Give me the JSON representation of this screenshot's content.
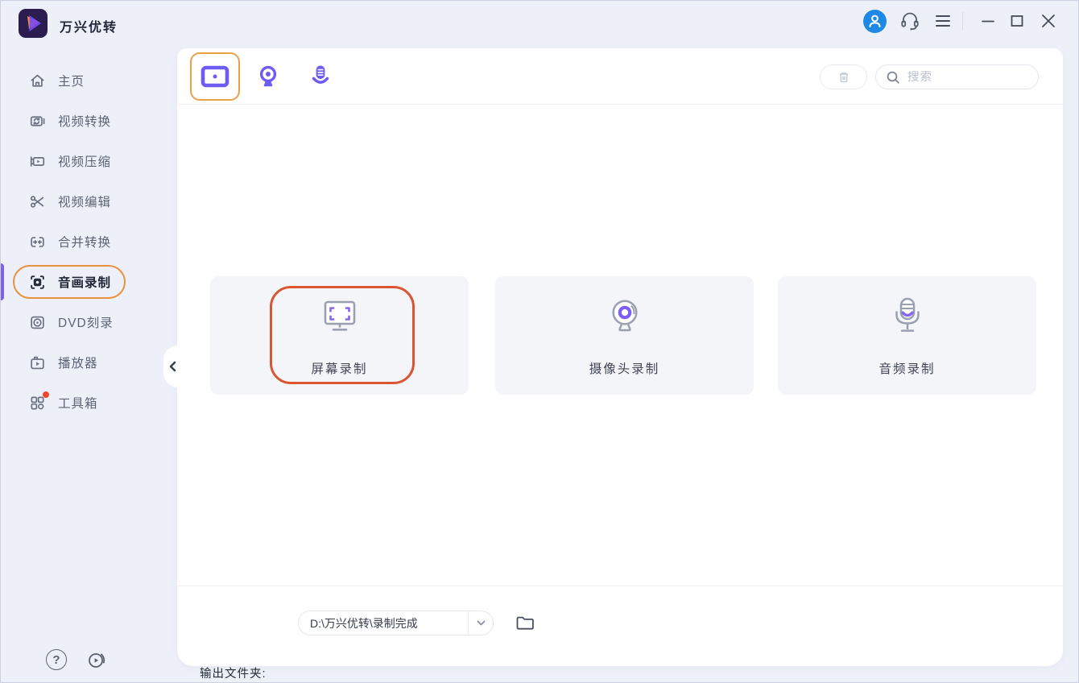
{
  "app": {
    "title": "万兴优转"
  },
  "titlebar": {
    "icons": [
      "user-avatar-icon",
      "headset-icon",
      "menu-icon",
      "minimize-icon",
      "maximize-icon",
      "close-icon"
    ]
  },
  "sidebar": {
    "items": [
      {
        "label": "主页",
        "icon": "home-icon",
        "active": false
      },
      {
        "label": "视频转换",
        "icon": "video-convert-icon",
        "active": false
      },
      {
        "label": "视频压缩",
        "icon": "video-compress-icon",
        "active": false
      },
      {
        "label": "视频编辑",
        "icon": "video-edit-icon",
        "active": false
      },
      {
        "label": "合并转换",
        "icon": "merge-convert-icon",
        "active": false
      },
      {
        "label": "音画录制",
        "icon": "record-icon",
        "active": true,
        "highlight": "orange-outline"
      },
      {
        "label": "DVD刻录",
        "icon": "dvd-icon",
        "active": false
      },
      {
        "label": "播放器",
        "icon": "player-icon",
        "active": false
      },
      {
        "label": "工具箱",
        "icon": "toolbox-icon",
        "active": false,
        "badge": "red-dot"
      }
    ]
  },
  "toolbar": {
    "tabs": [
      {
        "name": "screen-record-tab",
        "selected": true
      },
      {
        "name": "webcam-record-tab",
        "selected": false
      },
      {
        "name": "audio-record-tab",
        "selected": false
      }
    ],
    "delete_button_icon": "trash-icon",
    "search": {
      "placeholder": "搜索",
      "icon": "search-icon"
    }
  },
  "cards": [
    {
      "label": "屏幕录制",
      "icon": "screen-monitor-icon",
      "highlighted": true
    },
    {
      "label": "摄像头录制",
      "icon": "webcam-icon",
      "highlighted": false
    },
    {
      "label": "音频录制",
      "icon": "microphone-icon",
      "highlighted": false
    }
  ],
  "footer": {
    "output_label": "输出文件夹:",
    "output_path": "D:\\万兴优转\\录制完成",
    "help_glyph": "?"
  },
  "colors": {
    "accent_purple": "#6e5cf2",
    "sidebar_indicator_purple": "#7e63ea",
    "highlight_orange": "#e8923f",
    "annotation_red_orange": "#dc5531",
    "avatar_blue": "#1e88e5",
    "badge_red": "#f0452e",
    "window_bg": "#edf0f8",
    "panel_bg": "#ffffff",
    "card_bg": "#f4f5f9"
  }
}
